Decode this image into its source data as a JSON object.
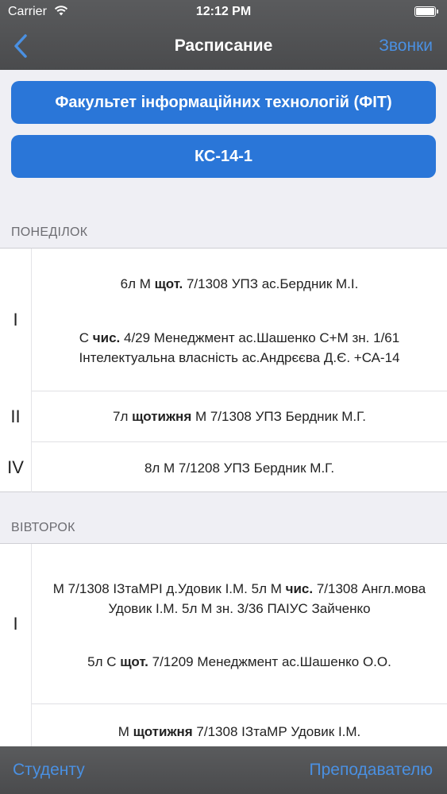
{
  "status_bar": {
    "carrier": "Carrier",
    "time": "12:12 PM"
  },
  "nav": {
    "title": "Расписание",
    "right_button": "Звонки"
  },
  "selectors": {
    "faculty": "Факультет інформаційних технологій (ФІТ)",
    "group": "КС-14-1"
  },
  "days": [
    {
      "name": "ПОНЕДІЛОК",
      "lessons": [
        {
          "number": "I",
          "entries": [
            {
              "lines": [
                [
                  {
                    "t": "6л М "
                  },
                  {
                    "t": "щот.",
                    "b": true
                  },
                  {
                    "t": " 7/1308 УПЗ ас.Бердник М.І."
                  }
                ]
              ]
            },
            {
              "lines": [
                [
                  {
                    "t": "С "
                  },
                  {
                    "t": "чис.",
                    "b": true
                  },
                  {
                    "t": " 4/29 Менеджмент ас.Шашенко С+М зн. 1/61"
                  }
                ],
                [
                  {
                    "t": "Інтелектуальна власність ас.Андрєєва Д.Є. +СА-14"
                  }
                ]
              ]
            }
          ]
        },
        {
          "number": "II",
          "entries": [
            {
              "lines": [
                [
                  {
                    "t": "7л "
                  },
                  {
                    "t": "щотижня",
                    "b": true
                  },
                  {
                    "t": " М 7/1308 УПЗ Бердник М.Г."
                  }
                ]
              ]
            }
          ]
        },
        {
          "number": "IV",
          "entries": [
            {
              "lines": [
                [
                  {
                    "t": "8л М 7/1208 УПЗ Бердник М.Г."
                  }
                ]
              ]
            }
          ]
        }
      ]
    },
    {
      "name": "ВІВТОРОК",
      "lessons": [
        {
          "number": "I",
          "entries": [
            {
              "lines": [
                [
                  {
                    "t": "М 7/1308 ІЗтаМРІ д.Удовик І.М. 5л М "
                  },
                  {
                    "t": "чис.",
                    "b": true
                  },
                  {
                    "t": " 7/1308 Англ.мова"
                  }
                ],
                [
                  {
                    "t": "Удовик І.М. 5л М зн. 3/36 ПАІУС Зайченко"
                  }
                ]
              ]
            },
            {
              "lines": [
                [
                  {
                    "t": "5л С "
                  },
                  {
                    "t": "щот.",
                    "b": true
                  },
                  {
                    "t": " 7/1209 Менеджмент ас.Шашенко О.О."
                  }
                ]
              ]
            }
          ]
        },
        {
          "number": "",
          "entries": [
            {
              "lines": [
                [
                  {
                    "t": "М "
                  },
                  {
                    "t": "щотижня",
                    "b": true
                  },
                  {
                    "t": " 7/1308 ІЗтаМР Удовик І.М."
                  }
                ]
              ]
            }
          ]
        }
      ]
    }
  ],
  "toolbar": {
    "student": "Студенту",
    "teacher": "Преподавателю"
  },
  "icons": {
    "back": "chevron-left-icon",
    "wifi": "wifi-icon",
    "battery": "battery-icon"
  },
  "colors": {
    "accent": "#4a90e2",
    "button_blue": "#2a76d8",
    "bar_gray": "#525355"
  }
}
